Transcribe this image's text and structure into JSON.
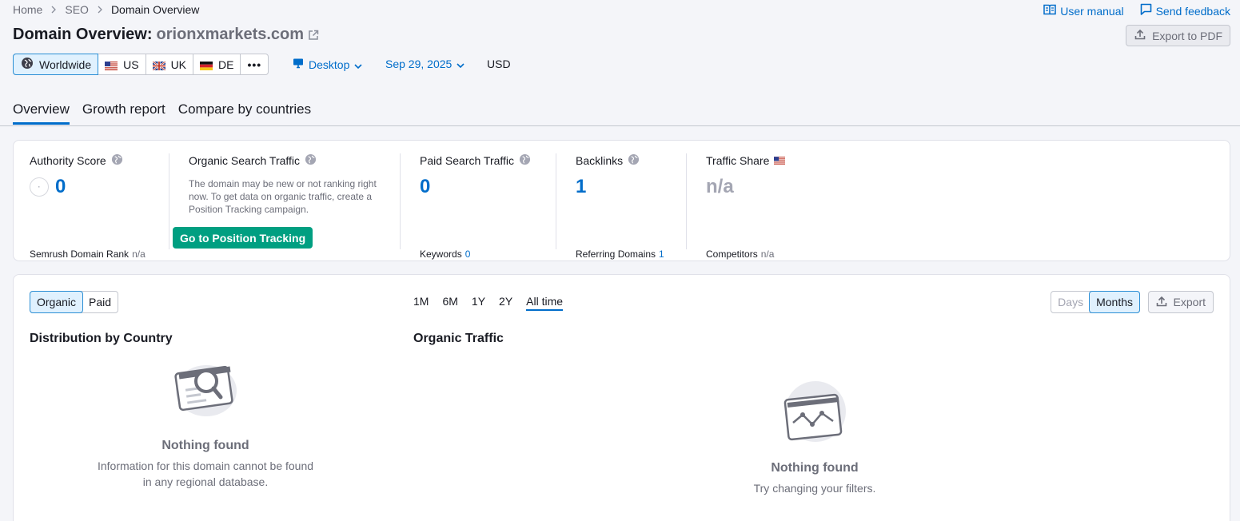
{
  "breadcrumb": [
    "Home",
    "SEO",
    "Domain Overview"
  ],
  "top_links": {
    "manual": "User manual",
    "feedback": "Send feedback"
  },
  "title": {
    "prefix": "Domain Overview:",
    "domain": "orionxmarkets.com"
  },
  "export_pdf": "Export to PDF",
  "regions": [
    {
      "label": "Worldwide",
      "icon": "globe-icon",
      "active": true
    },
    {
      "label": "US",
      "icon": "us-flag-icon"
    },
    {
      "label": "UK",
      "icon": "uk-flag-icon"
    },
    {
      "label": "DE",
      "icon": "de-flag-icon"
    },
    {
      "label": "•••",
      "icon": "more-icon"
    }
  ],
  "device": "Desktop",
  "date": "Sep 29, 2025",
  "currency": "USD",
  "tabs": [
    "Overview",
    "Growth report",
    "Compare by countries"
  ],
  "metrics": {
    "authority": {
      "label": "Authority Score",
      "value": "0",
      "foot_label": "Semrush Domain Rank",
      "foot_value": "n/a"
    },
    "organic": {
      "label": "Organic Search Traffic",
      "note": "The domain may be new or not ranking right now. To get data on organic traffic, create a Position Tracking campaign.",
      "button": "Go to Position Tracking"
    },
    "paid": {
      "label": "Paid Search Traffic",
      "value": "0",
      "foot_label": "Keywords",
      "foot_value": "0"
    },
    "backlinks": {
      "label": "Backlinks",
      "value": "1",
      "foot_label": "Referring Domains",
      "foot_value": "1"
    },
    "share": {
      "label": "Traffic Share",
      "value": "n/a",
      "foot_label": "Competitors",
      "foot_value": "n/a"
    }
  },
  "bottom": {
    "type_toggle": [
      "Organic",
      "Paid"
    ],
    "periods": [
      "1M",
      "6M",
      "1Y",
      "2Y",
      "All time"
    ],
    "granularity": [
      "Days",
      "Months"
    ],
    "export": "Export",
    "dist_title": "Distribution by Country",
    "dist_empty_title": "Nothing found",
    "dist_empty_text": "Information for this domain cannot be found in any regional database.",
    "traffic_title": "Organic Traffic",
    "traffic_empty_title": "Nothing found",
    "traffic_empty_text": "Try changing your filters."
  }
}
